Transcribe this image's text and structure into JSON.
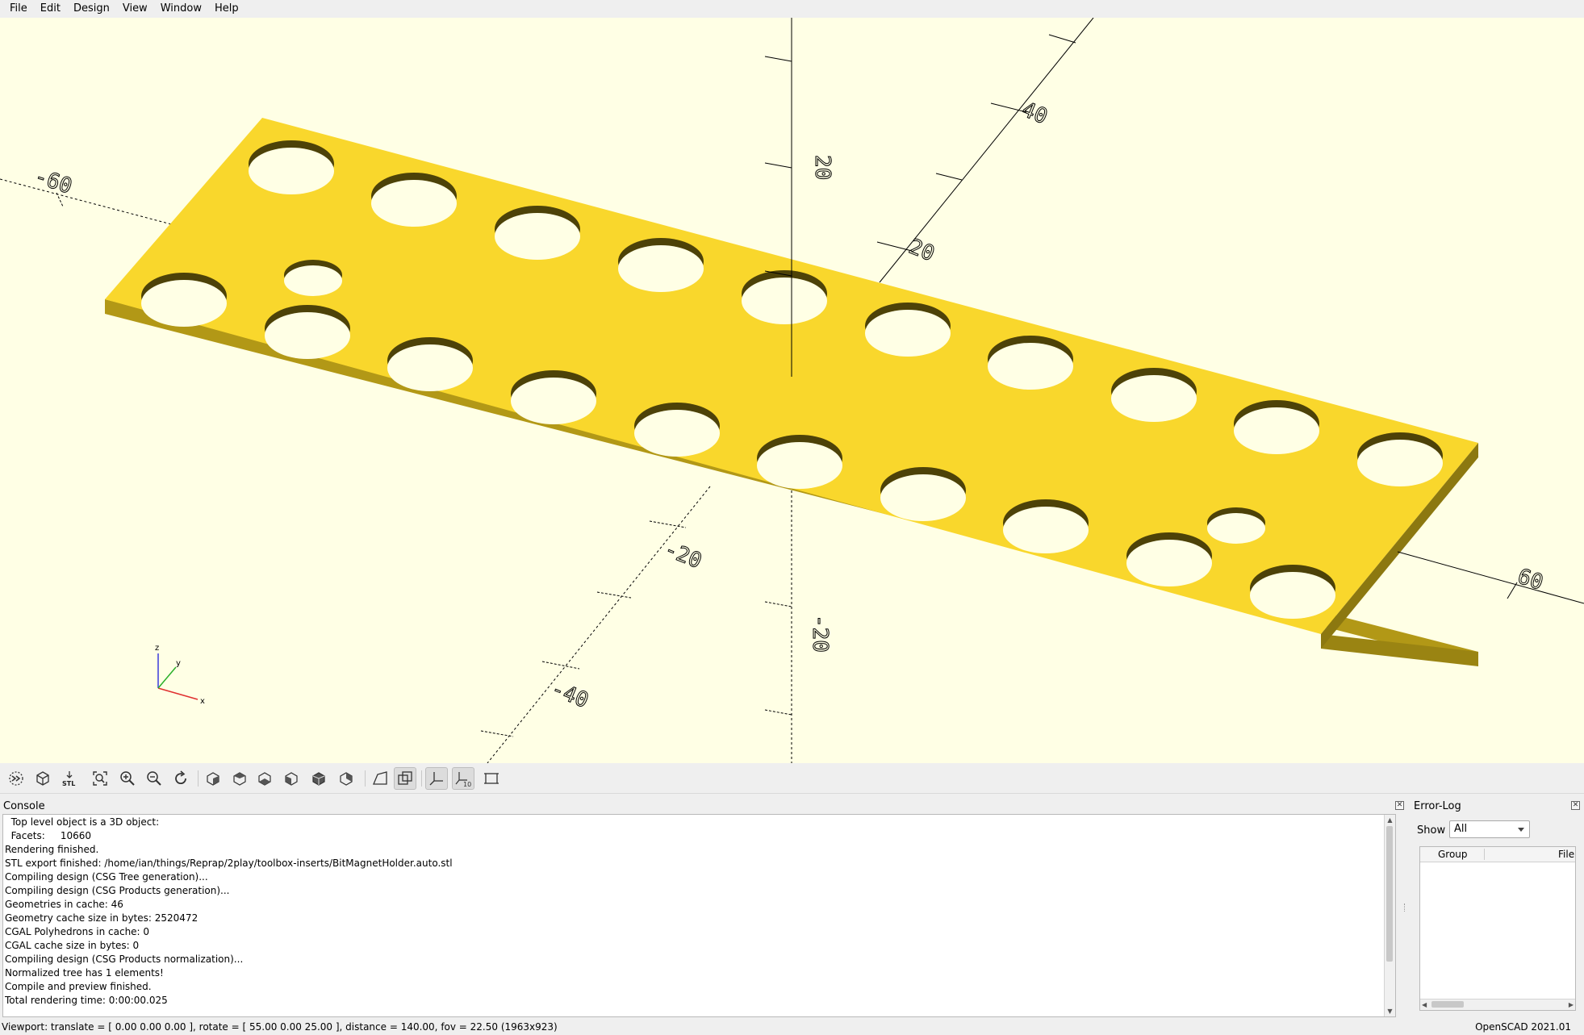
{
  "menu": [
    "File",
    "Edit",
    "Design",
    "View",
    "Window",
    "Help"
  ],
  "viewport": {
    "background": "#ffffe5",
    "plate_color": "#f9d72c",
    "axis_labels": {
      "x_neg": "-60",
      "x_pos": "60",
      "y_pos_far": "40",
      "y_pos_near": "20",
      "y_neg_near": "-20",
      "y_neg_far": "-40",
      "z_pos": "20",
      "z_neg": "-20"
    },
    "gizmo": {
      "x": "x",
      "y": "y",
      "z": "z"
    }
  },
  "toolbar": {
    "buttons": [
      {
        "name": "preview",
        "icon": "preview-icon"
      },
      {
        "name": "render",
        "icon": "render-icon"
      },
      {
        "name": "export-stl",
        "icon": "stl-icon",
        "label": "STL"
      },
      {
        "name": "view-all",
        "icon": "view-all-icon"
      },
      {
        "name": "zoom-in",
        "icon": "zoom-in-icon"
      },
      {
        "name": "zoom-out",
        "icon": "zoom-out-icon"
      },
      {
        "name": "reset-view",
        "icon": "reset-view-icon"
      },
      {
        "name": "view-right",
        "icon": "view-right-icon"
      },
      {
        "name": "view-top",
        "icon": "view-top-icon"
      },
      {
        "name": "view-bottom",
        "icon": "view-bottom-icon"
      },
      {
        "name": "view-left",
        "icon": "view-left-icon"
      },
      {
        "name": "view-front",
        "icon": "view-front-icon"
      },
      {
        "name": "view-back",
        "icon": "view-back-icon"
      },
      {
        "name": "perspective",
        "icon": "perspective-icon"
      },
      {
        "name": "orthogonal",
        "icon": "orthogonal-icon",
        "active": true
      },
      {
        "name": "show-axes",
        "icon": "axes-icon",
        "active": true
      },
      {
        "name": "show-scale-markers",
        "icon": "scale-markers-icon",
        "active": true,
        "label": "10"
      },
      {
        "name": "show-edges",
        "icon": "edges-icon"
      }
    ]
  },
  "console": {
    "title": "Console",
    "lines": [
      "  Top level object is a 3D object:",
      "  Facets:     10660",
      "Rendering finished.",
      "STL export finished: /home/ian/things/Reprap/2play/toolbox-inserts/BitMagnetHolder.auto.stl",
      "Compiling design (CSG Tree generation)...",
      "Compiling design (CSG Products generation)...",
      "Geometries in cache: 46",
      "Geometry cache size in bytes: 2520472",
      "CGAL Polyhedrons in cache: 0",
      "CGAL cache size in bytes: 0",
      "Compiling design (CSG Products normalization)...",
      "Normalized tree has 1 elements!",
      "Compile and preview finished.",
      "Total rendering time: 0:00:00.025"
    ]
  },
  "errorlog": {
    "title": "Error-Log",
    "show_label": "Show",
    "show_value": "All",
    "columns": [
      "Group",
      "File"
    ]
  },
  "status": {
    "viewport": "Viewport: translate = [ 0.00 0.00 0.00 ], rotate = [ 55.00 0.00 25.00 ], distance = 140.00, fov = 22.50 (1963x923)",
    "version": "OpenSCAD 2021.01"
  }
}
